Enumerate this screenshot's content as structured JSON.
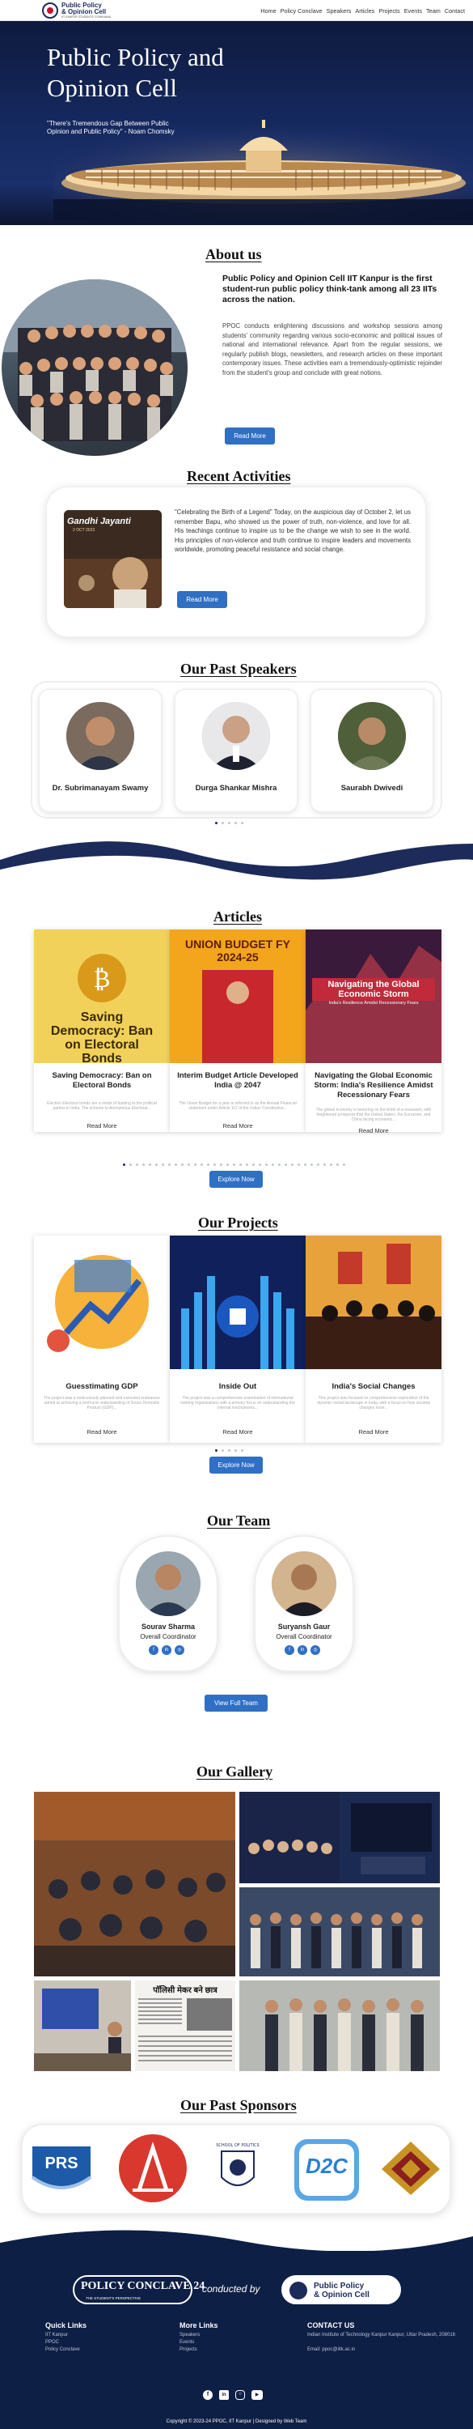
{
  "header": {
    "brand_line1": "Public Policy",
    "brand_line2": "& Opinion Cell",
    "brand_line3": "IIT KANPUR STUDENTS' GYMKHANA",
    "nav": [
      "Home",
      "Policy Conclave",
      "Speakers",
      "Articles",
      "Projects",
      "Events",
      "Team",
      "Contact"
    ]
  },
  "hero": {
    "title": "Public Policy and Opinion Cell",
    "quote": "\"There's Tremendous Gap Between Public Opinion and Public Policy\" - Noam Chomsky"
  },
  "about": {
    "heading": "About us",
    "lead": "Public Policy and Opinion Cell IIT Kanpur is the first student-run public policy think-tank among all 23 IITs across the nation.",
    "body": "PPOC conducts enlightening discussions and workshop sessions among students' community regarding various socio-economic and political issues of national and international relevance. Apart from the regular sessions, we regularly publish blogs, newsletters, and research articles on these important contemporary issues. These activities earn a tremendously-optimistic rejoinder from the student's group and conclude with great notions.",
    "button": "Read More"
  },
  "activities": {
    "heading": "Recent Activities",
    "image_text": "Gandhi Jayanti",
    "image_subtext": "2 OCT 2023",
    "text": "\"Celebrating the Birth of a Legend\" Today, on the auspicious day of October 2, let us remember Bapu, who showed us the power of truth, non-violence, and love for all. His teachings continue to inspire us to be the change we wish to see in the world. His principles of non-violence and truth continue to inspire leaders and movements worldwide, promoting peaceful resistance and social change.",
    "button": "Read More"
  },
  "speakers": {
    "heading": "Our Past Speakers",
    "items": [
      {
        "name": "Dr. Subrimanayam Swamy"
      },
      {
        "name": "Durga Shankar Mishra"
      },
      {
        "name": "Saurabh Dwivedi"
      }
    ]
  },
  "articles": {
    "heading": "Articles",
    "items": [
      {
        "img_text": "Saving Democracy: Ban on Electoral Bonds",
        "title": "Saving Democracy: Ban on Electoral Bonds",
        "excerpt": "Election Electoral bonds are a mode of funding to the political parties in India. The scheme to Anonymous Electoral...",
        "more": "Read More"
      },
      {
        "img_text": "UNION BUDGET FY 2024-25",
        "title": "Interim Budget Article Developed India @ 2047",
        "excerpt": "The Union Budget for a year is referred to as the Annual Financial statement under Article 112 of the Indian Constitution...",
        "more": "Read More"
      },
      {
        "img_text": "Navigating the Global Economic Storm",
        "img_sub": "India's Resilience Amidst Recessionary Fears",
        "title": "Navigating the Global Economic Storm: India's Resilience Amidst Recessionary Fears",
        "excerpt": "The global economy is teetering on the brink of a recession, with heightened prospects that the United States, the Eurozone, and China facing economic...",
        "more": "Read More"
      }
    ],
    "button": "Explore Now"
  },
  "projects": {
    "heading": "Our Projects",
    "items": [
      {
        "title": "Guesstimating GDP",
        "excerpt": "The project was a meticulously planned and executed endeavour aimed at achieving a profound understanding of Gross Domestic Product (GDP)...",
        "more": "Read More"
      },
      {
        "title": "Inside Out",
        "excerpt": "The project was a comprehensive examination of international ranking organizations with a primary focus on understanding the internal mechanisms...",
        "more": "Read More"
      },
      {
        "title": "India's Social Changes",
        "excerpt": "This project was focused on comprehensive exploration of the dynamic social landscape in India, with a focus on how societal changes have...",
        "more": "Read More"
      }
    ],
    "button": "Explore Now"
  },
  "team": {
    "heading": "Our Team",
    "members": [
      {
        "name": "Sourav Sharma",
        "role": "Overall Coordinator"
      },
      {
        "name": "Suryansh Gaur",
        "role": "Overall Coordinator"
      }
    ],
    "button": "View Full Team"
  },
  "gallery": {
    "heading": "Our Gallery",
    "banner_text": "पॉलिसी मेकर बने छात्र"
  },
  "sponsors": {
    "heading": "Our Past Sponsors",
    "logos": [
      "PRS",
      "Congress",
      "School of Politics",
      "D2C",
      "Sponsor"
    ]
  },
  "footer": {
    "conclave": "POLICY CONCLAVE 24",
    "conclave_sub": "THE STUDENT'S PERSPECTIVE",
    "conducted_by": "conducted by",
    "cell_line1": "Public Policy",
    "cell_line2": "& Opinion Cell",
    "quick_links_title": "Quick Links",
    "quick_links": [
      "IIT Kanpur",
      "PPOC",
      "Policy Conclave"
    ],
    "more_links_title": "More Links",
    "more_links": [
      "Speakers",
      "Events",
      "Projects"
    ],
    "contact_title": "CONTACT US",
    "address": "Indian Institute of Technology Kanpur Kanpur, Uttar Pradesh, 208016",
    "email": "Email: ppoc@iitk.ac.in",
    "copyright": "Copyright © 2023-24 PPOC, IIT Kanpur | Designed by Web Team"
  },
  "colors": {
    "navy": "#0e1f45",
    "accent": "#2f6fc4"
  }
}
